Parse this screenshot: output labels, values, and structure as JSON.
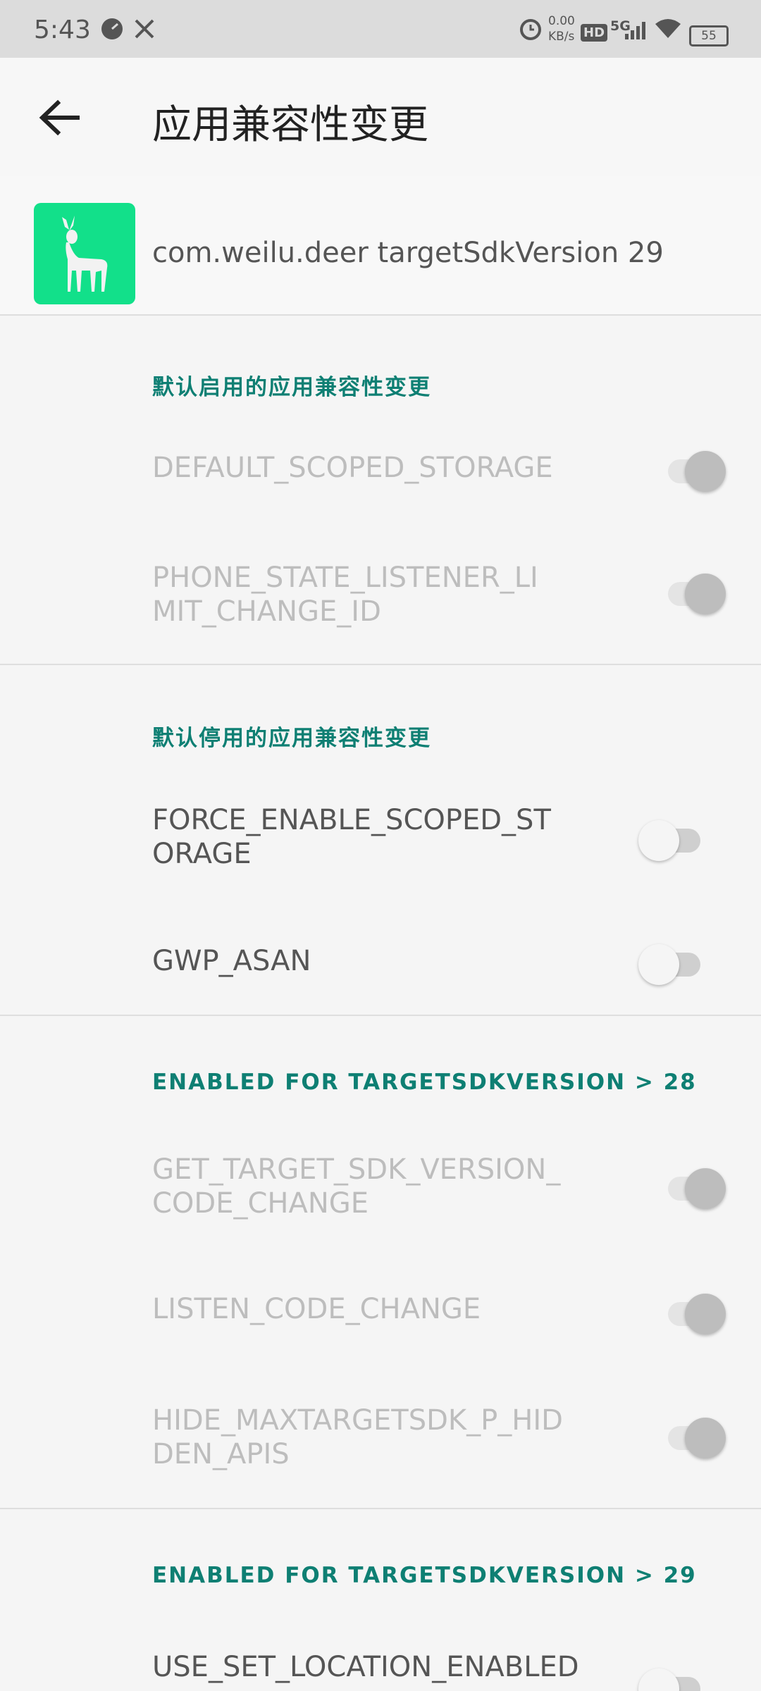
{
  "status_bar": {
    "time": "5:43",
    "net_speed_value": "0.00",
    "net_speed_unit": "KB/s",
    "hd": "HD",
    "signal": "5G",
    "battery": "55",
    "icons": [
      "speedometer-icon",
      "tools-icon",
      "alarm-icon",
      "signal-icon",
      "wifi-icon",
      "battery-icon"
    ]
  },
  "app_bar": {
    "title": "应用兼容性变更",
    "back_icon": "arrow-left-icon"
  },
  "app_info": {
    "text": "com.weilu.deer targetSdkVersion 29",
    "icon": "deer-app-icon",
    "icon_color": "#12e08a"
  },
  "sections": [
    {
      "header": "默认启用的应用兼容性变更",
      "items": [
        {
          "label": "DEFAULT_SCOPED_STORAGE",
          "state": "on",
          "enabled": false
        },
        {
          "label": "PHONE_STATE_LISTENER_LIMIT_CHANGE_ID",
          "state": "on",
          "enabled": false
        }
      ]
    },
    {
      "header": "默认停用的应用兼容性变更",
      "items": [
        {
          "label": "FORCE_ENABLE_SCOPED_STORAGE",
          "state": "off",
          "enabled": true
        },
        {
          "label": "GWP_ASAN",
          "state": "off",
          "enabled": true
        }
      ]
    },
    {
      "header": "ENABLED FOR TARGETSDKVERSION > 28",
      "items": [
        {
          "label": "GET_TARGET_SDK_VERSION_CODE_CHANGE",
          "state": "on",
          "enabled": false
        },
        {
          "label": "LISTEN_CODE_CHANGE",
          "state": "on",
          "enabled": false
        },
        {
          "label": "HIDE_MAXTARGETSDK_P_HIDDEN_APIS",
          "state": "on",
          "enabled": false
        }
      ]
    },
    {
      "header": "ENABLED FOR TARGETSDKVERSION > 29",
      "items": [
        {
          "label": "USE_SET_LOCATION_ENABLED",
          "state": "off",
          "enabled": true
        }
      ]
    }
  ],
  "colors": {
    "accent": "#0e7f73",
    "disabled_text": "#bdbdbd",
    "enabled_text": "#555555"
  }
}
